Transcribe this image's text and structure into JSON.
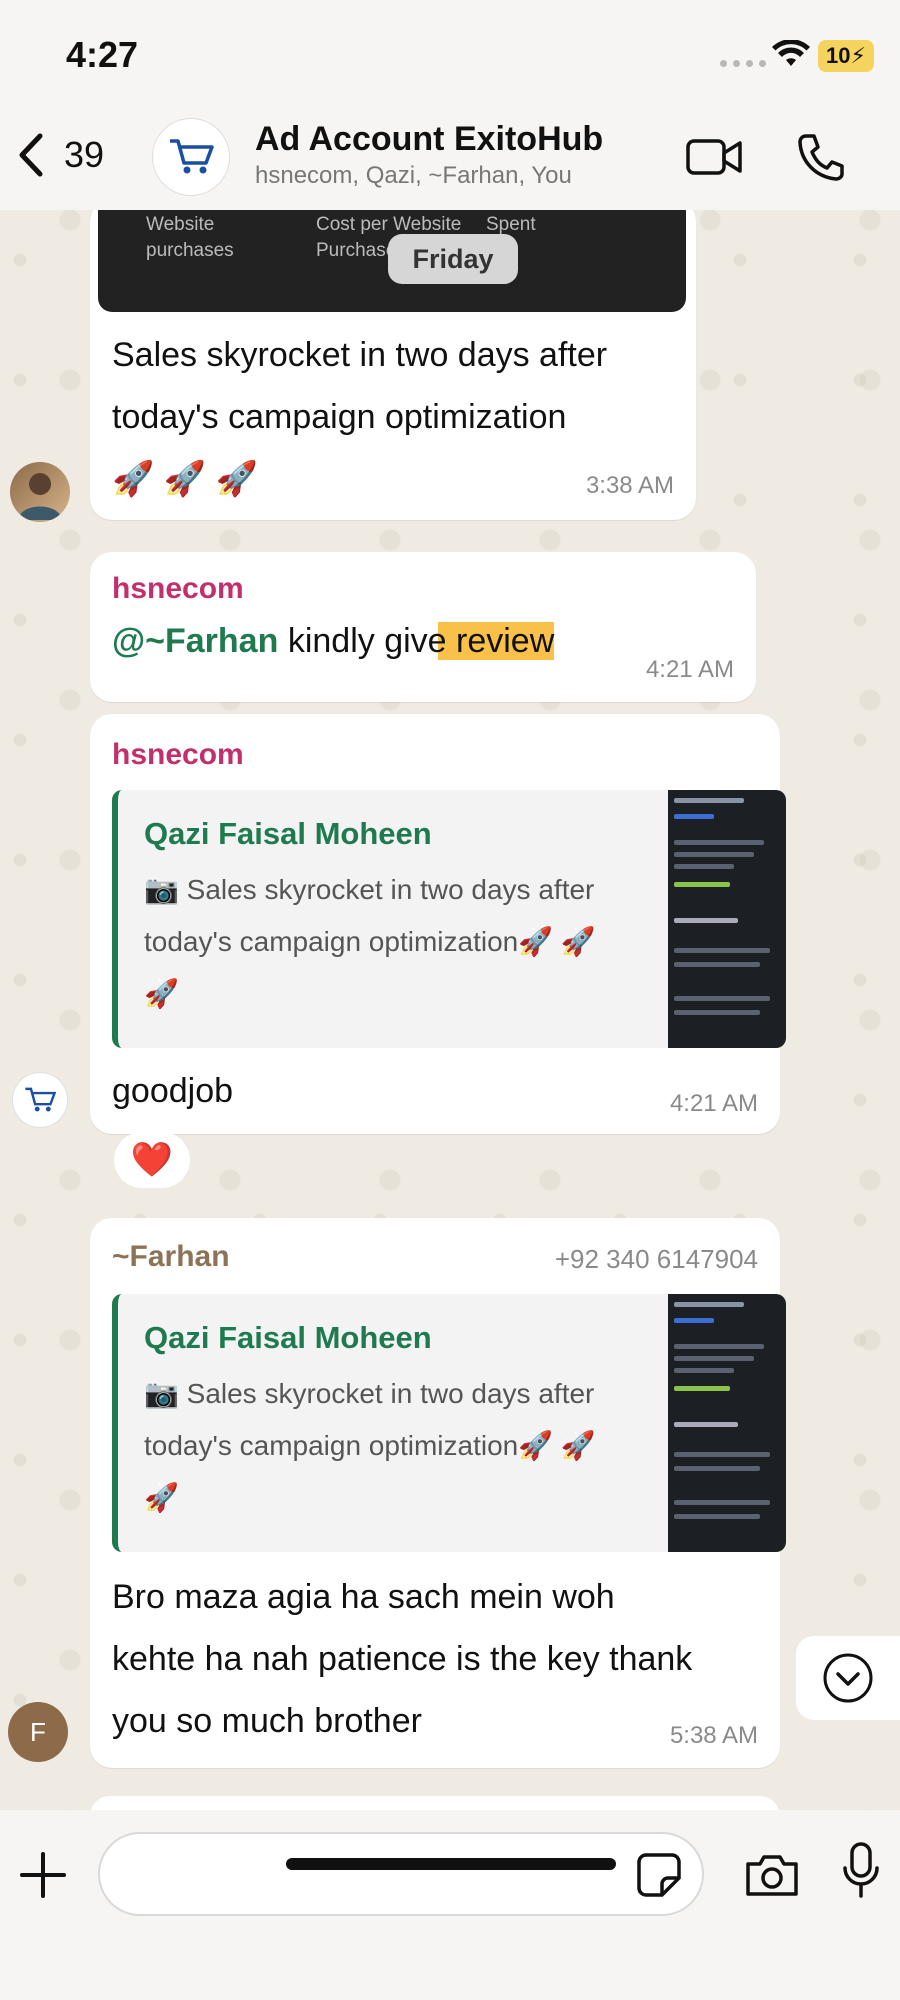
{
  "status_bar": {
    "time": "4:27",
    "battery": "10"
  },
  "header": {
    "back_count": "39",
    "title": "Ad Account ExitoHub",
    "subtitle": "hsnecom, Qazi, ~Farhan, You"
  },
  "date_chip": "Friday",
  "embedded_screenshot": {
    "col1": [
      "Website",
      "purchases"
    ],
    "col2": [
      "Cost per Website",
      "Purchase"
    ],
    "col3": [
      "Spent"
    ]
  },
  "messages": [
    {
      "text_lines": [
        "Sales skyrocket in two days after",
        "today's campaign optimization",
        "🚀 🚀 🚀"
      ],
      "time": "3:38 AM"
    },
    {
      "sender": "hsnecom",
      "mention": "@~Farhan",
      "text": " kindly give review",
      "time": "4:21 AM"
    },
    {
      "sender": "hsnecom",
      "quote_author": "Qazi Faisal Moheen",
      "quote_lines": [
        "📷 Sales skyrocket in two days after",
        "today's campaign optimization🚀 🚀",
        "🚀"
      ],
      "text": "goodjob",
      "time": "4:21 AM",
      "reaction": "❤️"
    },
    {
      "sender": "~Farhan",
      "phone": "+92 340 6147904",
      "quote_author": "Qazi Faisal Moheen",
      "quote_lines": [
        "📷 Sales skyrocket in two days after",
        "today's campaign optimization🚀 🚀",
        "🚀"
      ],
      "text_lines": [
        "Bro maza agia ha sach mein woh",
        "kehte ha nah patience is the key thank",
        "you so much brother"
      ],
      "time": "5:38 AM",
      "avatar_letter": "F"
    }
  ],
  "composer": {
    "placeholder": ""
  },
  "colors": {
    "hsnecom": "#c2306b",
    "farhan": "#8c7355",
    "mention": "#1f7a4f",
    "quote_accent": "#1f7a4f",
    "highlight": "#f9c14a"
  },
  "icons": [
    "back-chevron-icon",
    "cart-icon",
    "video-call-icon",
    "phone-icon",
    "camera-icon",
    "chevron-down-icon",
    "plus-icon",
    "sticker-icon",
    "mic-icon",
    "wifi-icon"
  ]
}
